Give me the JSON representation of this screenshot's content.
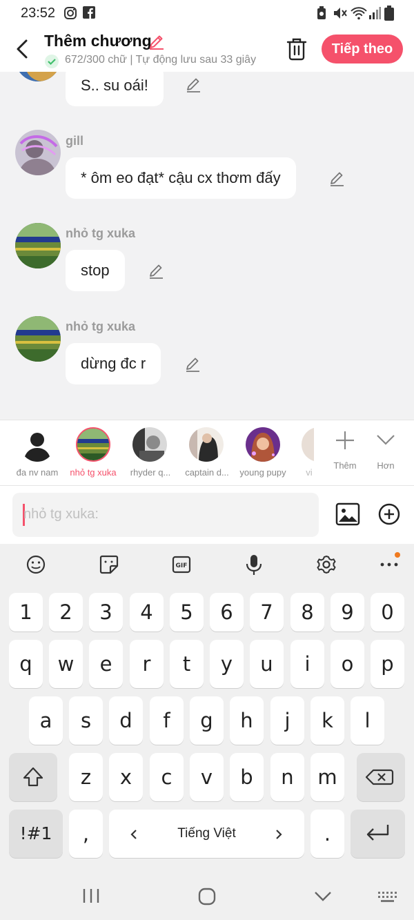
{
  "status_bar": {
    "time": "23:52"
  },
  "header": {
    "title": "Thêm chương",
    "subtitle": "672/300 chữ | Tự động lưu sau 33 giây",
    "next_label": "Tiếp theo"
  },
  "messages": [
    {
      "name": "",
      "text": "S.. su oái!"
    },
    {
      "name": "gill",
      "text": "* ôm eo đạt* cậu cx thơm đấy"
    },
    {
      "name": "nhỏ tg xuka",
      "text": "stop"
    },
    {
      "name": "nhỏ tg xuka",
      "text": "dừng đc r"
    }
  ],
  "characters": [
    {
      "name": "đa nv nam"
    },
    {
      "name": "nhỏ tg xuka"
    },
    {
      "name": "rhyder   q..."
    },
    {
      "name": "captain   d..."
    },
    {
      "name": "young pupy"
    },
    {
      "name": "vi"
    }
  ],
  "char_actions": {
    "add_label": "Thêm",
    "more_label": "Hơn"
  },
  "composer": {
    "placeholder": "nhỏ tg xuka:"
  },
  "keyboard": {
    "row_numbers": [
      "1",
      "2",
      "3",
      "4",
      "5",
      "6",
      "7",
      "8",
      "9",
      "0"
    ],
    "row1": [
      "q",
      "w",
      "e",
      "r",
      "t",
      "y",
      "u",
      "i",
      "o",
      "p"
    ],
    "row2": [
      "a",
      "s",
      "d",
      "f",
      "g",
      "h",
      "j",
      "k",
      "l"
    ],
    "row3": [
      "z",
      "x",
      "c",
      "v",
      "b",
      "n",
      "m"
    ],
    "symbols_label": "!#1",
    "comma": ",",
    "space_label": "Tiếng Việt",
    "period": "."
  },
  "colors": {
    "accent": "#f5516b",
    "check_green": "#3fbf6b"
  }
}
